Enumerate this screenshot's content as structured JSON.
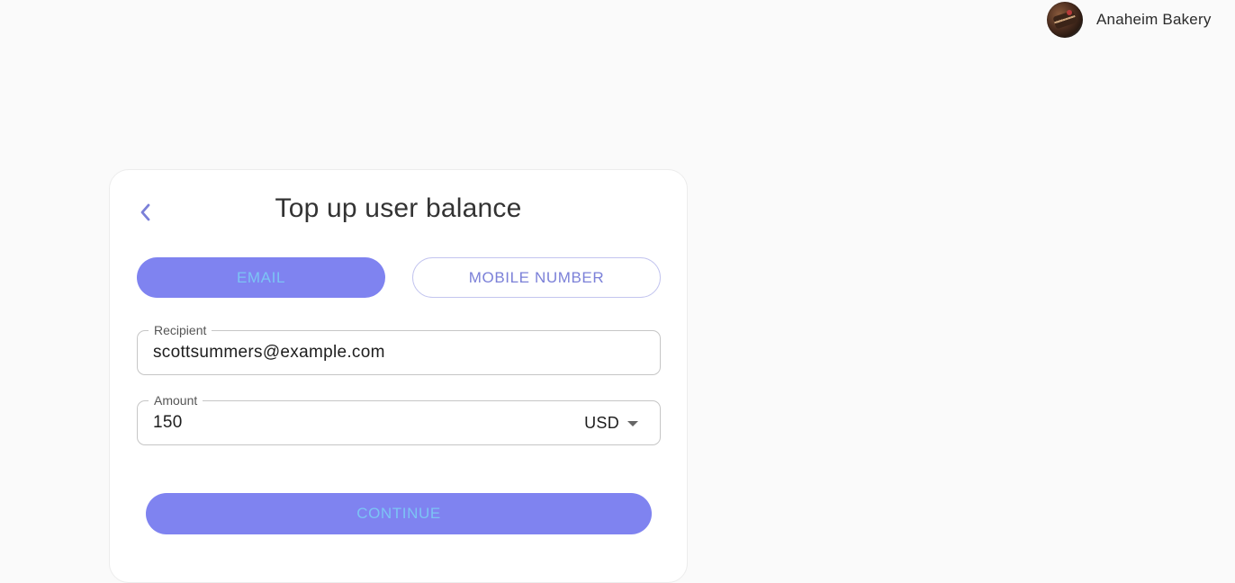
{
  "account": {
    "name": "Anaheim Bakery",
    "avatar_icon": "bakery-avatar-icon"
  },
  "form": {
    "title": "Top up user balance",
    "back_icon": "chevron-left-icon",
    "tabs": [
      {
        "label": "EMAIL",
        "selected": true
      },
      {
        "label": "MOBILE NUMBER",
        "selected": false
      }
    ],
    "recipient": {
      "label": "Recipient",
      "value": "scottsummers@example.com"
    },
    "amount": {
      "label": "Amount",
      "value": "150",
      "currency": "USD",
      "currency_icon": "caret-down-icon"
    },
    "continue_label": "CONTINUE"
  },
  "colors": {
    "accent": "#7f83f0",
    "accent_text": "#7cc4f4",
    "outline_tab_text": "#7b80d8",
    "background": "#fafafa"
  }
}
